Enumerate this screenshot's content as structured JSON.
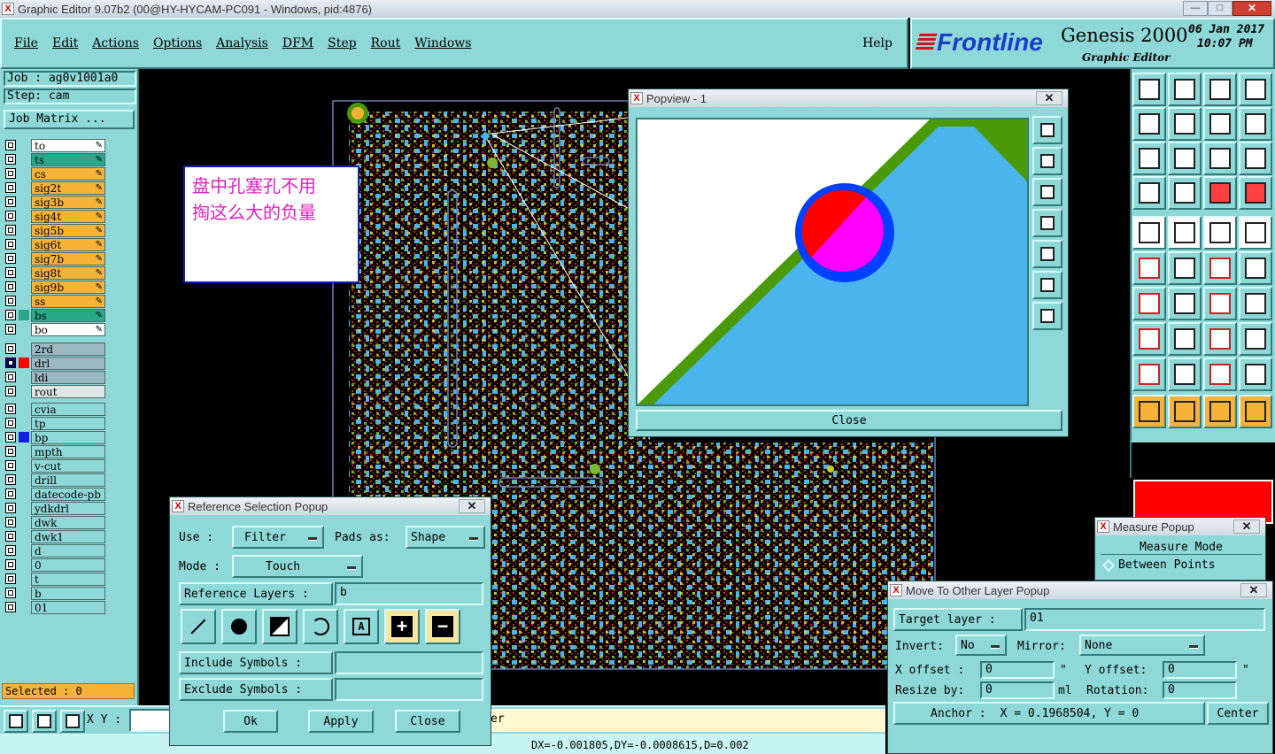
{
  "window": {
    "title": "Graphic Editor 9.07b2 (00@HY-HYCAM-PC091 - Windows, pid:4876)"
  },
  "menu": {
    "items": [
      "File",
      "Edit",
      "Actions",
      "Options",
      "Analysis",
      "DFM",
      "Step",
      "Rout",
      "Windows"
    ],
    "help": "Help"
  },
  "brand": {
    "logo": "Frontline",
    "product": "Genesis 2000",
    "subtitle": "Graphic Editor",
    "date": "06 Jan 2017",
    "time": "10:07 PM"
  },
  "job": {
    "job_label": "Job : ag0v1001a0",
    "step_label": "Step: cam",
    "matrix_button": "Job Matrix ..."
  },
  "layers_board": [
    {
      "name": "to",
      "color": "#ffffff"
    },
    {
      "name": "ts",
      "color": "#2aa98a"
    },
    {
      "name": "cs",
      "color": "#f6b338"
    },
    {
      "name": "sig2t",
      "color": "#f6b338"
    },
    {
      "name": "sig3b",
      "color": "#f6b338"
    },
    {
      "name": "sig4t",
      "color": "#f6b338"
    },
    {
      "name": "sig5b",
      "color": "#f6b338"
    },
    {
      "name": "sig6t",
      "color": "#f6b338"
    },
    {
      "name": "sig7b",
      "color": "#f6b338"
    },
    {
      "name": "sig8t",
      "color": "#f6b338"
    },
    {
      "name": "sig9b",
      "color": "#f6b338"
    },
    {
      "name": "ss",
      "color": "#f6b338"
    },
    {
      "name": "bs",
      "color": "#2aa98a"
    },
    {
      "name": "bo",
      "color": "#ffffff"
    }
  ],
  "layers_drill": [
    {
      "name": "2rd",
      "color": "#9cb8c0"
    },
    {
      "name": "drl",
      "color": "#9cb8c0"
    },
    {
      "name": "ldi",
      "color": "#9cb8c0"
    },
    {
      "name": "rout",
      "color": "#dfe6e6"
    }
  ],
  "layers_misc": [
    "cvia",
    "tp",
    "bp",
    "mpth",
    "v-cut",
    "drill",
    "datecode-pb",
    "ydkdrl",
    "dwk",
    "dwk1",
    "d",
    "0",
    "t",
    "b",
    "01"
  ],
  "status": {
    "selected": "Selected : 0",
    "xy_label": "X Y :",
    "measure": "DX=-0.001805,DY=-0.0008615,D=0.002",
    "prompt_tail": "er"
  },
  "annotation": {
    "line1": "盘中孔塞孔不用",
    "line2": "掏这么大的负量"
  },
  "popview": {
    "title": "Popview - 1",
    "close": "Close"
  },
  "refsel": {
    "title": "Reference Selection Popup",
    "use_label": "Use  :",
    "use_value": "Filter",
    "pads_label": "Pads as:",
    "pads_value": "Shape",
    "mode_label": "Mode  :",
    "mode_value": "Touch",
    "ref_layers_label": "Reference Layers :",
    "ref_layers_value": "b",
    "include_label": "Include Symbols :",
    "exclude_label": "Exclude Symbols :",
    "ok": "Ok",
    "apply": "Apply",
    "close": "Close"
  },
  "measure_popup": {
    "title": "Measure Popup",
    "mode_label": "Measure Mode",
    "mode_value": "Between Points"
  },
  "move_popup": {
    "title": "Move To Other Layer Popup",
    "target_label": "Target layer :",
    "target_value": "01",
    "invert_label": "Invert:",
    "invert_value": "No",
    "mirror_label": "Mirror:",
    "mirror_value": "None",
    "xoff_label": "X offset :",
    "xoff_value": "0",
    "xoff_unit": "\"",
    "yoff_label": "Y offset:",
    "yoff_value": "0",
    "yoff_unit": "\"",
    "resize_label": "Resize by:",
    "resize_value": "0",
    "resize_unit": "ml",
    "rot_label": "Rotation:",
    "rot_value": "0",
    "anchor_label": "Anchor :",
    "anchor_value": "X = 0.1968504, Y = 0",
    "center": "Center"
  },
  "colors": {
    "teal": "#8fd8d8",
    "orange": "#f6b338",
    "pcb_blue": "#4ab4ec",
    "pcb_green": "#4a9a0a",
    "pad_red": "#ff0000",
    "pad_magenta": "#ff00ff",
    "pad_blue": "#0040ff"
  }
}
